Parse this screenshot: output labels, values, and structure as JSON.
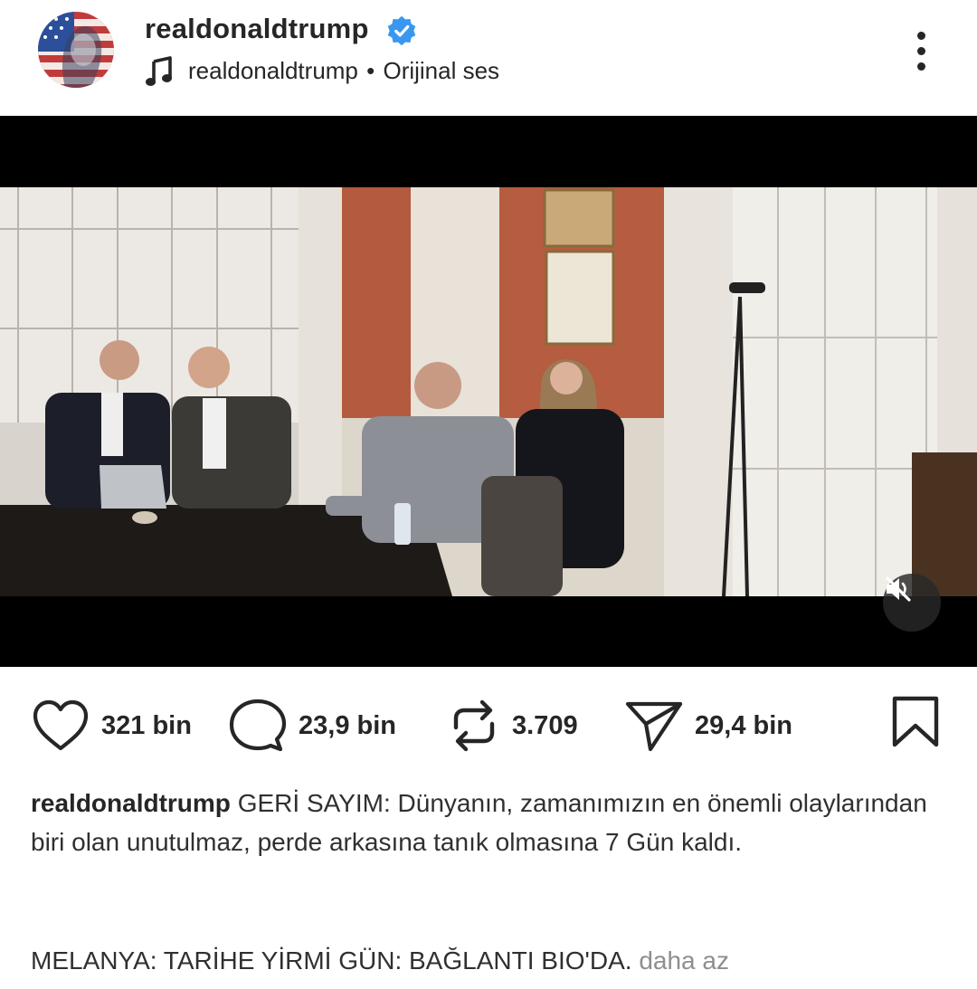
{
  "header": {
    "username": "realdonaldtrump",
    "audio_owner": "realdonaldtrump",
    "audio_separator": "•",
    "audio_title": "Orijinal ses"
  },
  "actions": {
    "likes": "321 bin",
    "comments": "23,9 bin",
    "reposts": "3.709",
    "shares": "29,4 bin"
  },
  "caption": {
    "username": "realdonaldtrump",
    "text": "GERİ SAYIM: Dünyanın, zamanımızın en önemli olaylarından biri olan unutulmaz, perde arkasına tanık olmasına 7 Gün kaldı.",
    "second_paragraph": "MELANYA: TARİHE YİRMİ GÜN: BAĞLANTI BIO'DA.",
    "less_link": "daha az"
  },
  "icons": {
    "verified": "verified-badge-icon",
    "audio": "music-note-icon",
    "more": "more-vertical-icon",
    "mute": "speaker-muted-icon",
    "like": "heart-icon",
    "comment": "comment-bubble-icon",
    "repost": "repost-icon",
    "share": "send-icon",
    "save": "bookmark-icon"
  },
  "colors": {
    "verified": "#3897f0",
    "text": "#262626",
    "muted_text": "#8e8e8e"
  }
}
